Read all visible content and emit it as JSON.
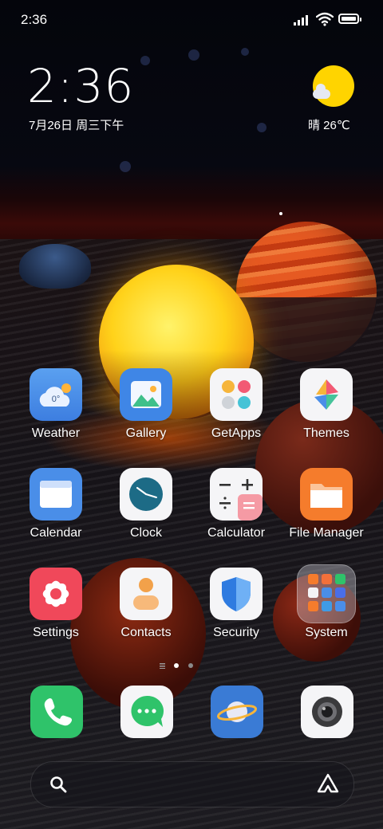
{
  "status_bar": {
    "time": "2:36"
  },
  "clock_widget": {
    "time": "2:36",
    "date": "7月26日 周三下午"
  },
  "weather_widget": {
    "text": "晴 26℃"
  },
  "apps": [
    {
      "label": "Weather",
      "icon": "weather-icon",
      "temp": "0°"
    },
    {
      "label": "Gallery",
      "icon": "gallery-icon"
    },
    {
      "label": "GetApps",
      "icon": "getapps-icon"
    },
    {
      "label": "Themes",
      "icon": "themes-icon"
    },
    {
      "label": "Calendar",
      "icon": "calendar-icon"
    },
    {
      "label": "Clock",
      "icon": "clock-icon"
    },
    {
      "label": "Calculator",
      "icon": "calculator-icon"
    },
    {
      "label": "File Manager",
      "icon": "folder-icon"
    },
    {
      "label": "Settings",
      "icon": "settings-icon"
    },
    {
      "label": "Contacts",
      "icon": "contacts-icon"
    },
    {
      "label": "Security",
      "icon": "shield-icon"
    },
    {
      "label": "System",
      "icon": "folder-grid-icon"
    }
  ],
  "page_indicator": {
    "pages": 2,
    "active": 0
  },
  "dock": [
    {
      "icon": "phone-icon"
    },
    {
      "icon": "messages-icon"
    },
    {
      "icon": "browser-icon"
    },
    {
      "icon": "camera-icon"
    }
  ],
  "search_bar": {
    "left_icon": "search-icon",
    "right_icon": "assistant-icon"
  },
  "colors": {
    "weather": "#4a8ee8",
    "gallery": "#3f86e6",
    "calendar": "#4a8ee8",
    "clock_face": "#1d6b86",
    "file_manager": "#f57c2c",
    "settings": "#f0485a",
    "phone": "#2fc36a",
    "browser": "#3a7bd5"
  }
}
